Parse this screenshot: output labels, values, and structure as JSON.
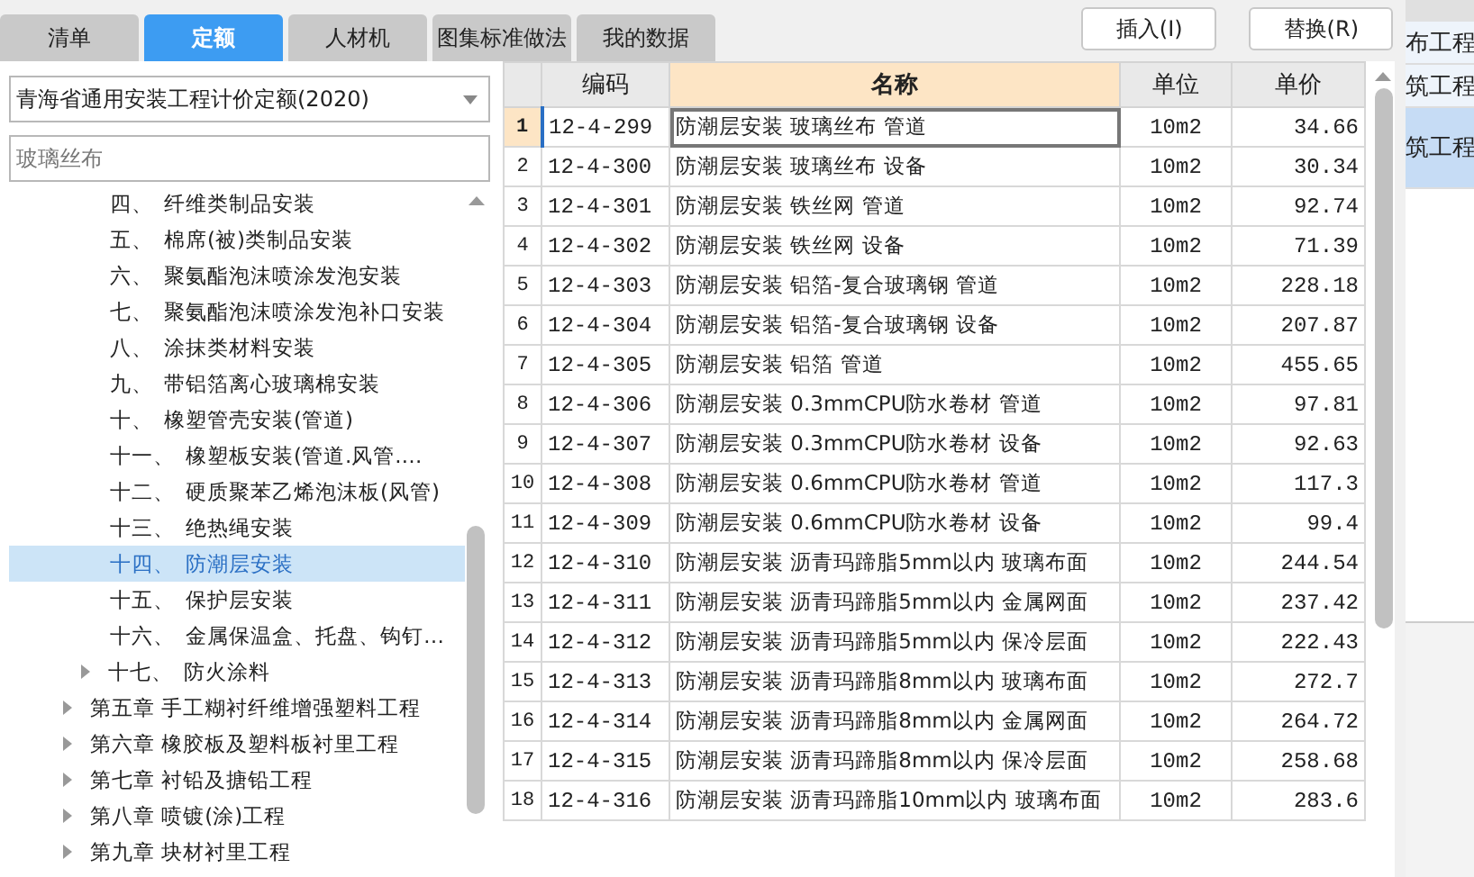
{
  "tabs": [
    {
      "label": "清单",
      "selected": false
    },
    {
      "label": "定额",
      "selected": true
    },
    {
      "label": "人材机",
      "selected": false
    },
    {
      "label": "图集标准做法",
      "selected": false
    },
    {
      "label": "我的数据",
      "selected": false
    }
  ],
  "buttons": [
    "插入(I)",
    "替换(R)"
  ],
  "quota_select": {
    "value": "青海省通用安装工程计价定额(2020)"
  },
  "search": {
    "value": "玻璃丝布"
  },
  "tree": {
    "sections": [
      {
        "number": "四、",
        "label": "纤维类制品安装",
        "selected": false,
        "expandable": false
      },
      {
        "number": "五、",
        "label": "棉席(被)类制品安装",
        "selected": false,
        "expandable": false
      },
      {
        "number": "六、",
        "label": "聚氨酯泡沫喷涂发泡安装",
        "selected": false,
        "expandable": false
      },
      {
        "number": "七、",
        "label": "聚氨酯泡沫喷涂发泡补口安装",
        "selected": false,
        "expandable": false
      },
      {
        "number": "八、",
        "label": "涂抹类材料安装",
        "selected": false,
        "expandable": false
      },
      {
        "number": "九、",
        "label": "带铝箔离心玻璃棉安装",
        "selected": false,
        "expandable": false
      },
      {
        "number": "十、",
        "label": "橡塑管壳安装(管道)",
        "selected": false,
        "expandable": false
      },
      {
        "number": "十一、",
        "label": "橡塑板安装(管道.风管.…",
        "selected": false,
        "expandable": false
      },
      {
        "number": "十二、",
        "label": "硬质聚苯乙烯泡沫板(风管)",
        "selected": false,
        "expandable": false
      },
      {
        "number": "十三、",
        "label": "绝热绳安装",
        "selected": false,
        "expandable": false
      },
      {
        "number": "十四、",
        "label": "防潮层安装",
        "selected": true,
        "expandable": false
      },
      {
        "number": "十五、",
        "label": "保护层安装",
        "selected": false,
        "expandable": false
      },
      {
        "number": "十六、",
        "label": "金属保温盒、托盘、钩钉…",
        "selected": false,
        "expandable": false
      },
      {
        "number": "十七、",
        "label": "防火涂料",
        "selected": false,
        "expandable": true
      }
    ],
    "chapters": [
      {
        "label": "第五章 手工糊衬纤维增强塑料工程",
        "expanded": false
      },
      {
        "label": "第六章 橡胶板及塑料板衬里工程",
        "expanded": false
      },
      {
        "label": "第七章 衬铅及搪铅工程",
        "expanded": false
      },
      {
        "label": "第八章 喷镀(涂)工程",
        "expanded": false
      },
      {
        "label": "第九章 块材衬里工程",
        "expanded": false
      }
    ]
  },
  "table": {
    "columns": [
      "编码",
      "名称",
      "单位",
      "单价"
    ],
    "rows": [
      {
        "no": "1",
        "code": "12-4-299",
        "name": "防潮层安装 玻璃丝布 管道",
        "unit": "10m2",
        "price": "34.66",
        "selected": true
      },
      {
        "no": "2",
        "code": "12-4-300",
        "name": "防潮层安装 玻璃丝布 设备",
        "unit": "10m2",
        "price": "30.34",
        "selected": false
      },
      {
        "no": "3",
        "code": "12-4-301",
        "name": "防潮层安装 铁丝网 管道",
        "unit": "10m2",
        "price": "92.74",
        "selected": false
      },
      {
        "no": "4",
        "code": "12-4-302",
        "name": "防潮层安装 铁丝网 设备",
        "unit": "10m2",
        "price": "71.39",
        "selected": false
      },
      {
        "no": "5",
        "code": "12-4-303",
        "name": "防潮层安装 铝箔-复合玻璃钢 管道",
        "unit": "10m2",
        "price": "228.18",
        "selected": false
      },
      {
        "no": "6",
        "code": "12-4-304",
        "name": "防潮层安装 铝箔-复合玻璃钢 设备",
        "unit": "10m2",
        "price": "207.87",
        "selected": false
      },
      {
        "no": "7",
        "code": "12-4-305",
        "name": "防潮层安装 铝箔 管道",
        "unit": "10m2",
        "price": "455.65",
        "selected": false
      },
      {
        "no": "8",
        "code": "12-4-306",
        "name": "防潮层安装 0.3mmCPU防水卷材 管道",
        "unit": "10m2",
        "price": "97.81",
        "selected": false
      },
      {
        "no": "9",
        "code": "12-4-307",
        "name": "防潮层安装 0.3mmCPU防水卷材 设备",
        "unit": "10m2",
        "price": "92.63",
        "selected": false
      },
      {
        "no": "10",
        "code": "12-4-308",
        "name": "防潮层安装 0.6mmCPU防水卷材 管道",
        "unit": "10m2",
        "price": "117.3",
        "selected": false
      },
      {
        "no": "11",
        "code": "12-4-309",
        "name": "防潮层安装 0.6mmCPU防水卷材 设备",
        "unit": "10m2",
        "price": "99.4",
        "selected": false
      },
      {
        "no": "12",
        "code": "12-4-310",
        "name": "防潮层安装 沥青玛蹄脂5mm以内 玻璃布面",
        "unit": "10m2",
        "price": "244.54",
        "selected": false
      },
      {
        "no": "13",
        "code": "12-4-311",
        "name": "防潮层安装 沥青玛蹄脂5mm以内 金属网面",
        "unit": "10m2",
        "price": "237.42",
        "selected": false
      },
      {
        "no": "14",
        "code": "12-4-312",
        "name": "防潮层安装 沥青玛蹄脂5mm以内 保冷层面",
        "unit": "10m2",
        "price": "222.43",
        "selected": false
      },
      {
        "no": "15",
        "code": "12-4-313",
        "name": "防潮层安装 沥青玛蹄脂8mm以内 玻璃布面",
        "unit": "10m2",
        "price": "272.7",
        "selected": false
      },
      {
        "no": "16",
        "code": "12-4-314",
        "name": "防潮层安装 沥青玛蹄脂8mm以内 金属网面",
        "unit": "10m2",
        "price": "264.72",
        "selected": false
      },
      {
        "no": "17",
        "code": "12-4-315",
        "name": "防潮层安装 沥青玛蹄脂8mm以内 保冷层面",
        "unit": "10m2",
        "price": "258.68",
        "selected": false
      },
      {
        "no": "18",
        "code": "12-4-316",
        "name": "防潮层安装 沥青玛蹄脂10mm以内 玻璃布面",
        "unit": "10m2",
        "price": "283.6",
        "selected": false
      }
    ]
  },
  "side_list": [
    {
      "label": "布工程",
      "selected": false
    },
    {
      "label": "筑工程",
      "selected": false
    },
    {
      "label": "筑工程",
      "selected": true
    }
  ]
}
